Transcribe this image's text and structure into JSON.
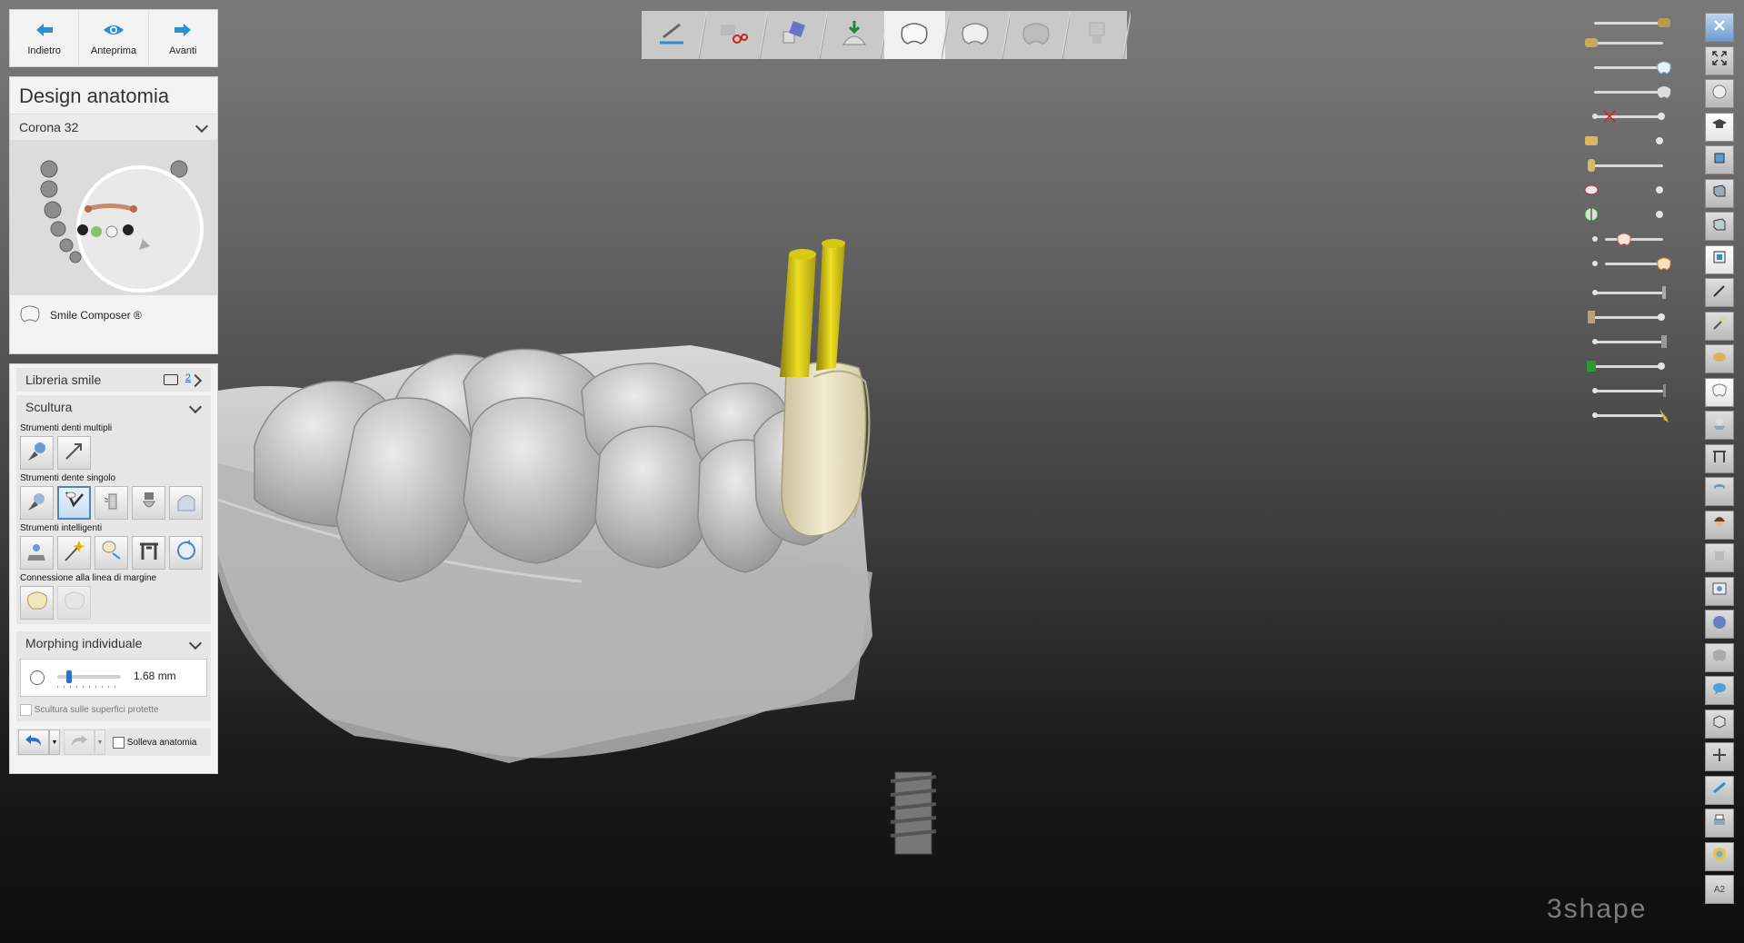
{
  "nav": {
    "back": "Indietro",
    "preview": "Anteprima",
    "next": "Avanti"
  },
  "design": {
    "title": "Design anatomia",
    "selected_crown": "Corona 32",
    "smile_composer": "Smile Composer ®"
  },
  "tools": {
    "library": "Libreria smile",
    "library_badge": "2",
    "sculpt": "Scultura",
    "multi_teeth": "Strumenti denti multipli",
    "single_tooth": "Strumenti dente singolo",
    "smart_tools": "Strumenti intelligenti",
    "margin_connection": "Connessione alla linea di margine",
    "morphing": "Morphing individuale",
    "morph_value": "1.68 mm",
    "protected_surfaces": "Scultura sulle superfici protette",
    "lift_anatomy": "Solleva anatomia"
  },
  "topbar": {
    "steps": [
      "prep-icon",
      "scissors-icon",
      "die-icon",
      "implant-icon",
      "crown-icon",
      "crown-alt-icon",
      "crown-outline-icon",
      "abutment-icon"
    ],
    "active_step": 4
  },
  "colors": {
    "accent": "#2b8fd4",
    "crown": "#ece5c8",
    "pin": "#d9c714",
    "model": "#cfcfcf"
  },
  "logo": "3shape"
}
